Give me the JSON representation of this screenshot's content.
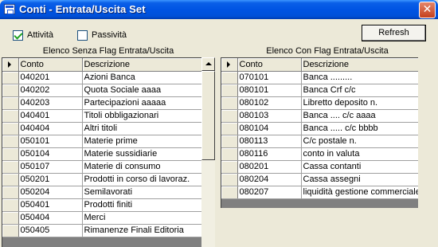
{
  "window": {
    "title": "Conti - Entrata/Uscita Set",
    "close_glyph": "✕"
  },
  "filters": {
    "attivita": {
      "label": "Attività",
      "checked": true
    },
    "passivita": {
      "label": "Passività",
      "checked": false
    }
  },
  "refresh_label": "Refresh",
  "left_grid": {
    "title": "Elenco Senza Flag Entrata/Uscita",
    "columns": [
      "Conto",
      "Descrizione"
    ],
    "rows": [
      [
        "040201",
        "Azioni Banca"
      ],
      [
        "040202",
        "Quota Sociale aaaa"
      ],
      [
        "040203",
        "Partecipazioni aaaaa"
      ],
      [
        "040401",
        "Titoli obbligazionari"
      ],
      [
        "040404",
        "Altri titoli"
      ],
      [
        "050101",
        "Materie prime"
      ],
      [
        "050104",
        "Materie sussidiarie"
      ],
      [
        "050107",
        "Materie di consumo"
      ],
      [
        "050201",
        "Prodotti in corso di lavoraz."
      ],
      [
        "050204",
        "Semilavorati"
      ],
      [
        "050401",
        "Prodotti finiti"
      ],
      [
        "050404",
        "Merci"
      ],
      [
        "050405",
        "Rimanenze Finali Editoria"
      ]
    ]
  },
  "right_grid": {
    "title": "Elenco Con Flag Entrata/Uscita",
    "columns": [
      "Conto",
      "Descrizione"
    ],
    "rows": [
      [
        "070101",
        "Banca ........."
      ],
      [
        "080101",
        "Banca Crf c/c"
      ],
      [
        "080102",
        "Libretto deposito n."
      ],
      [
        "080103",
        "Banca ....  c/c aaaa"
      ],
      [
        "080104",
        "Banca ..... c/c bbbb"
      ],
      [
        "080113",
        "C/c postale n."
      ],
      [
        "080116",
        "conto in valuta"
      ],
      [
        "080201",
        "Cassa contanti"
      ],
      [
        "080204",
        "Cassa assegni"
      ],
      [
        "080207",
        "liquidità gestione commerciale"
      ]
    ]
  }
}
